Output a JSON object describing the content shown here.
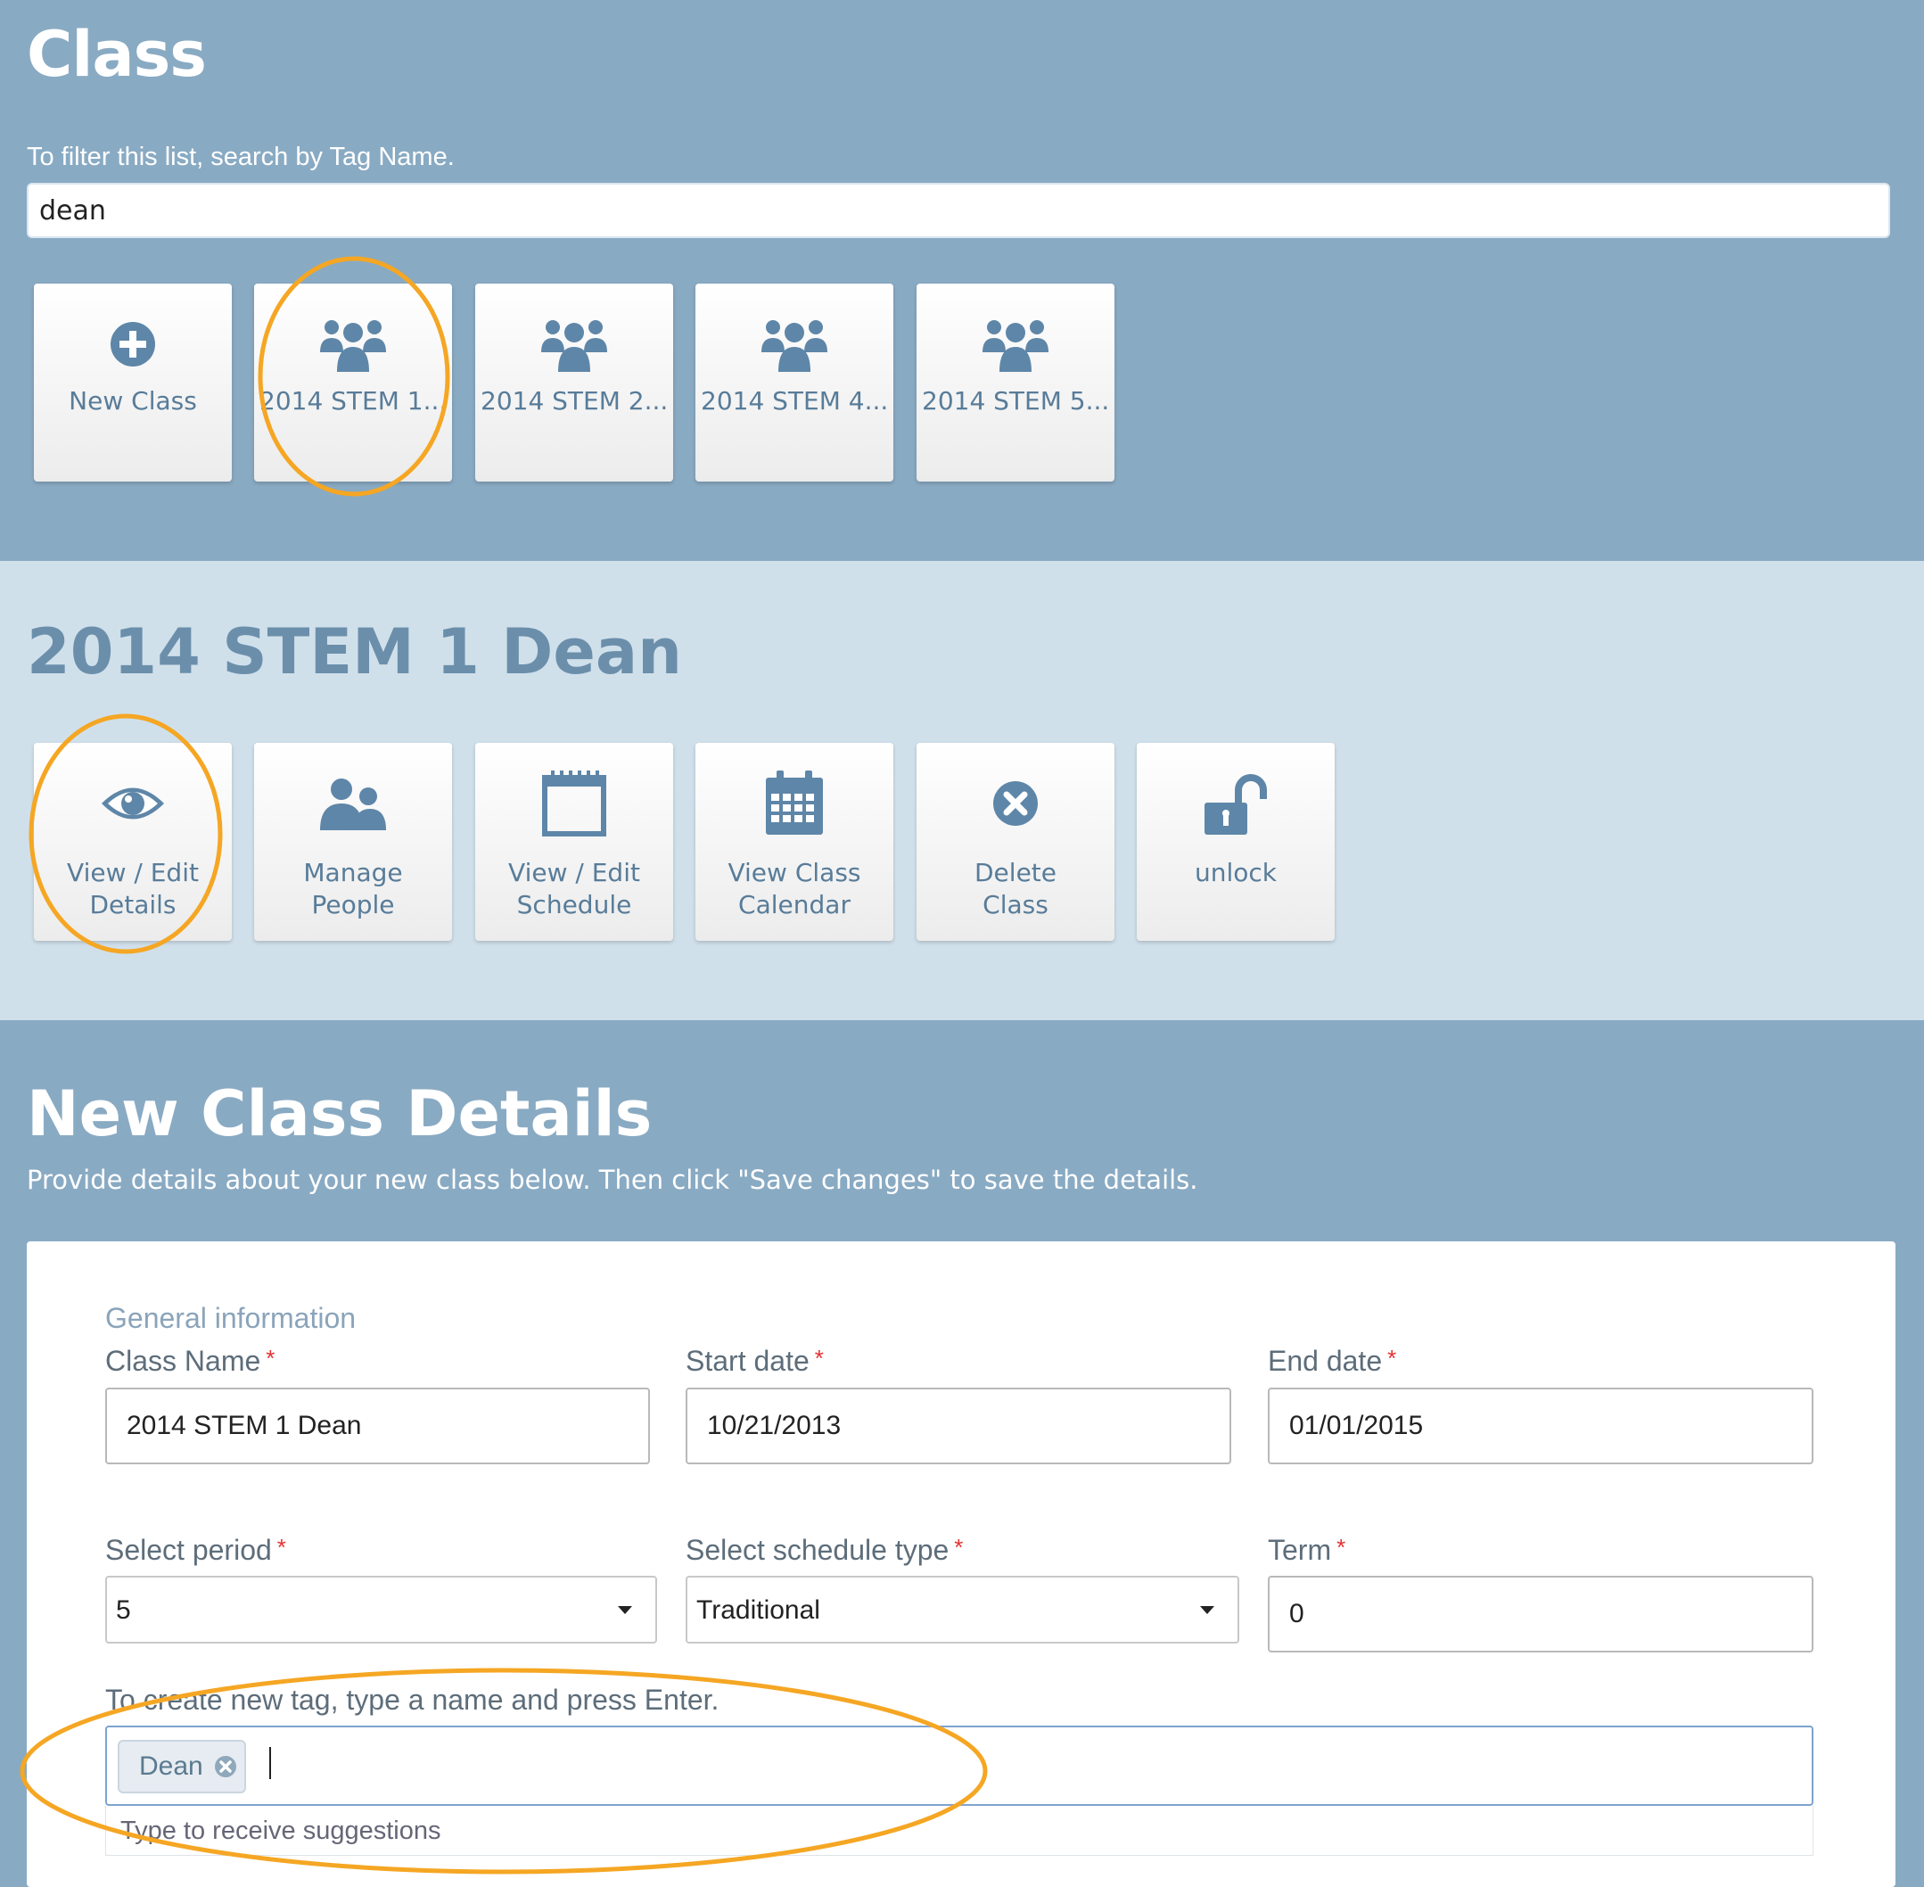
{
  "header": {
    "title": "Class",
    "filter_hint": "To filter this list, search by Tag Name.",
    "search_value": "dean"
  },
  "class_tiles": [
    {
      "label": "New Class",
      "icon": "plus-circle-icon"
    },
    {
      "label": "2014 STEM 1...",
      "icon": "group-icon"
    },
    {
      "label": "2014 STEM 2...",
      "icon": "group-icon"
    },
    {
      "label": "2014 STEM 4...",
      "icon": "group-icon"
    },
    {
      "label": "2014 STEM 5...",
      "icon": "group-icon"
    }
  ],
  "selected_class": {
    "title": "2014 STEM 1 Dean",
    "actions": [
      {
        "line1": "View / Edit",
        "line2": "Details",
        "icon": "eye-icon"
      },
      {
        "line1": "Manage",
        "line2": "People",
        "icon": "people-icon"
      },
      {
        "line1": "View / Edit",
        "line2": "Schedule",
        "icon": "notepad-icon"
      },
      {
        "line1": "View Class",
        "line2": "Calendar",
        "icon": "calendar-icon"
      },
      {
        "line1": "Delete",
        "line2": "Class",
        "icon": "delete-circle-icon"
      },
      {
        "line1": "unlock",
        "line2": "",
        "icon": "unlock-icon"
      }
    ]
  },
  "details": {
    "title": "New Class Details",
    "subtitle": "Provide details about your new class below. Then click \"Save changes\" to save the details.",
    "section_title": "General information",
    "fields": {
      "class_name": {
        "label": "Class Name",
        "value": "2014 STEM 1 Dean"
      },
      "start_date": {
        "label": "Start date",
        "value": "10/21/2013"
      },
      "end_date": {
        "label": "End date",
        "value": "01/01/2015"
      },
      "period": {
        "label": "Select period",
        "value": "5"
      },
      "schedule_type": {
        "label": "Select schedule type",
        "value": "Traditional"
      },
      "term": {
        "label": "Term",
        "value": "0"
      }
    },
    "required_marker": "*",
    "tag_hint": "To create new tag, type a name and press Enter.",
    "tags": [
      "Dean"
    ],
    "suggest_hint": "Type to receive suggestions"
  },
  "colors": {
    "band_dark": "#89aac3",
    "band_light": "#d0e0eb",
    "icon_blue": "#5e86a8",
    "annotation": "#f5a623",
    "required": "#e53232"
  }
}
